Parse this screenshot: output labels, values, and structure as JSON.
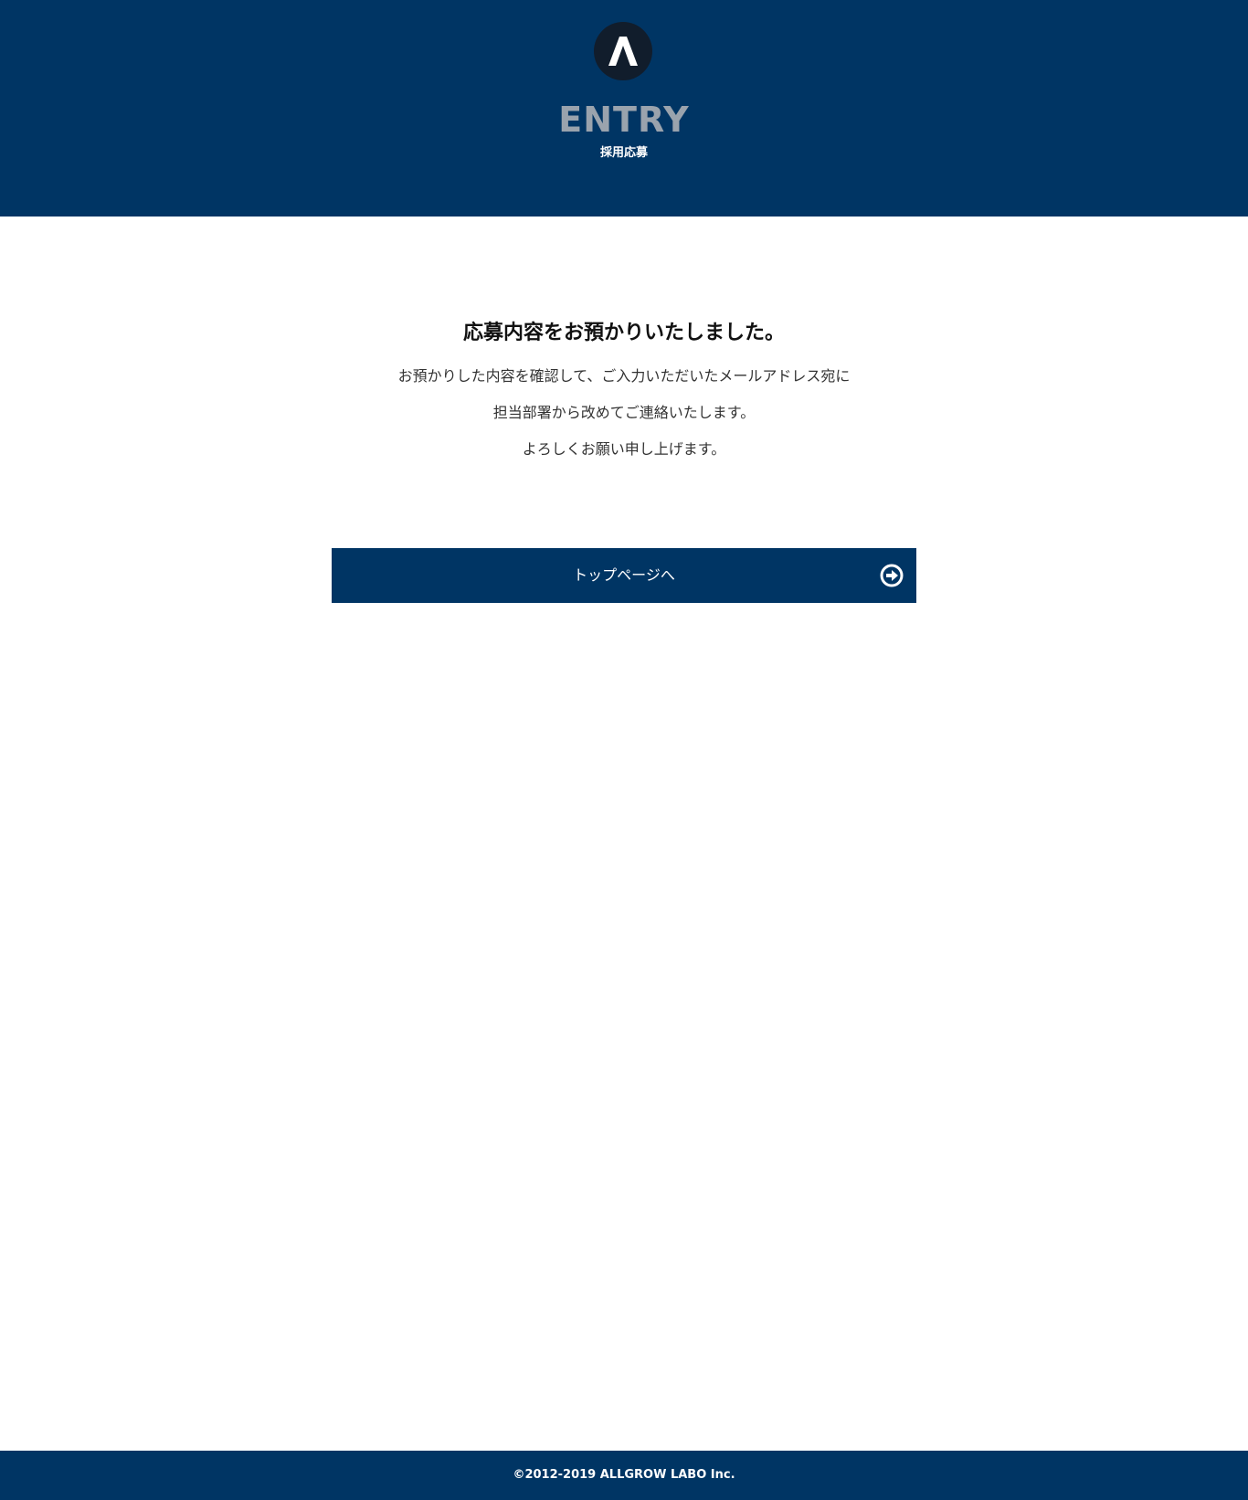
{
  "header": {
    "logo_icon": "allgrow-logo-icon",
    "title": "ENTRY",
    "subtitle": "採用応募"
  },
  "main": {
    "heading": "応募内容をお預かりいたしました。",
    "message_lines": [
      "お預かりした内容を確認して、ご入力いただいたメールアドレス宛に",
      "担当部署から改めてご連絡いたします。",
      "よろしくお願い申し上げます。"
    ],
    "top_button": {
      "label": "トップページへ",
      "icon": "arrow-circle-right-icon"
    }
  },
  "footer": {
    "copyright": "©2012-2019 ALLGROW LABO Inc."
  },
  "colors": {
    "brand_navy": "#003564",
    "logo_dark": "#111d2c",
    "title_gray": "#9aa3ad",
    "white": "#ffffff"
  }
}
